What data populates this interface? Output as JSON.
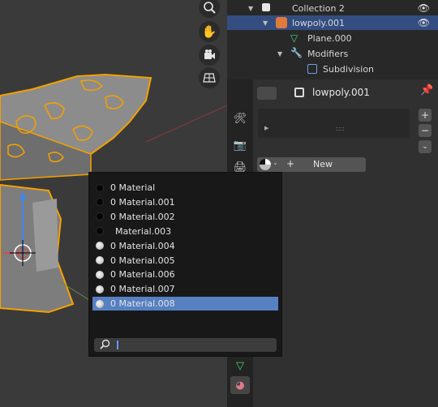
{
  "viewport": {
    "nav_icons": [
      "zoom-icon",
      "hand-icon",
      "camera-icon",
      "grid-icon"
    ]
  },
  "outliner": {
    "rows": [
      {
        "label": "Collection 2",
        "icon": "collection-checkbox-icon"
      },
      {
        "label": "lowpoly.001",
        "icon": "mesh-object-icon",
        "selected": true
      },
      {
        "label": "Plane.000",
        "icon": "mesh-data-icon"
      },
      {
        "label": "Modifiers",
        "icon": "wrench-icon"
      },
      {
        "label": "Subdivision",
        "icon": "subdivision-icon"
      }
    ]
  },
  "properties": {
    "object_name": "lowpoly.001",
    "new_label": "New",
    "slot_handle": "::::",
    "tabs": [
      "tool-icon",
      "render-icon",
      "output-icon",
      "mesh-data-icon",
      "material-icon"
    ]
  },
  "material_popup": {
    "items": [
      {
        "label": "0 Material",
        "swatch": "dark"
      },
      {
        "label": "0 Material.001",
        "swatch": "dark"
      },
      {
        "label": "0 Material.002",
        "swatch": "dark"
      },
      {
        "label": "Material.003",
        "swatch": "dark"
      },
      {
        "label": "0 Material.004",
        "swatch": "light"
      },
      {
        "label": "0 Material.005",
        "swatch": "light"
      },
      {
        "label": "0 Material.006",
        "swatch": "light"
      },
      {
        "label": "0 Material.007",
        "swatch": "light"
      },
      {
        "label": "0 Material.008",
        "swatch": "light",
        "selected": true
      }
    ],
    "search_value": ""
  },
  "colors": {
    "selection": "#334d80",
    "popup_selection": "#5680c2",
    "outline_orange": "#f5a000"
  }
}
